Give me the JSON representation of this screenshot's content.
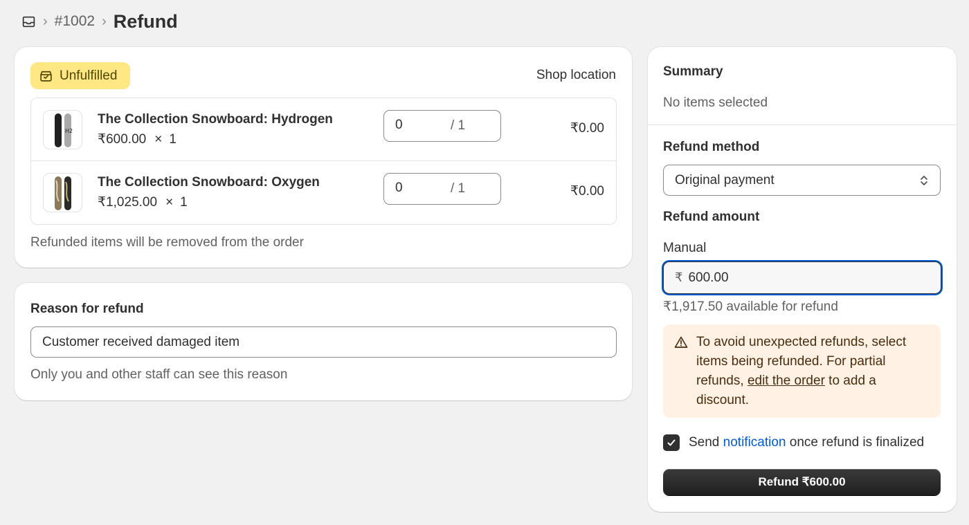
{
  "breadcrumb": {
    "home_icon": "orders-inbox-icon",
    "order_number": "#1002",
    "page_title": "Refund"
  },
  "items_card": {
    "status_badge": "Unfulfilled",
    "location": "Shop location",
    "items": [
      {
        "name": "The Collection Snowboard: Hydrogen",
        "unit_price": "₹600.00",
        "times": "×",
        "quantity": "1",
        "refund_qty": "0",
        "max_qty": "/ 1",
        "total": "₹0.00"
      },
      {
        "name": "The Collection Snowboard: Oxygen",
        "unit_price": "₹1,025.00",
        "times": "×",
        "quantity": "1",
        "refund_qty": "0",
        "max_qty": "/ 1",
        "total": "₹0.00"
      }
    ],
    "note": "Refunded items will be removed from the order"
  },
  "reason_card": {
    "label": "Reason for refund",
    "value": "Customer received damaged item",
    "help": "Only you and other staff can see this reason"
  },
  "summary": {
    "title": "Summary",
    "subtitle": "No items selected",
    "refund_method_label": "Refund method",
    "refund_method_value": "Original payment",
    "refund_amount_label": "Refund amount",
    "manual_label": "Manual",
    "currency_symbol": "₹",
    "amount_value": "600.00",
    "available": "₹1,917.50 available for refund",
    "warning": {
      "text_before": "To avoid unexpected refunds, select items being refunded. For partial refunds, ",
      "link": "edit the order",
      "text_after": " to add a discount."
    },
    "notify": {
      "checked": true,
      "before": "Send ",
      "link": "notification",
      "after": " once refund is finalized"
    },
    "refund_button": "Refund ₹600.00"
  },
  "colors": {
    "badge_bg": "#ffe784",
    "focus_ring": "#005bd3",
    "warning_bg": "#fff1e3",
    "primary_button": "#303030"
  }
}
